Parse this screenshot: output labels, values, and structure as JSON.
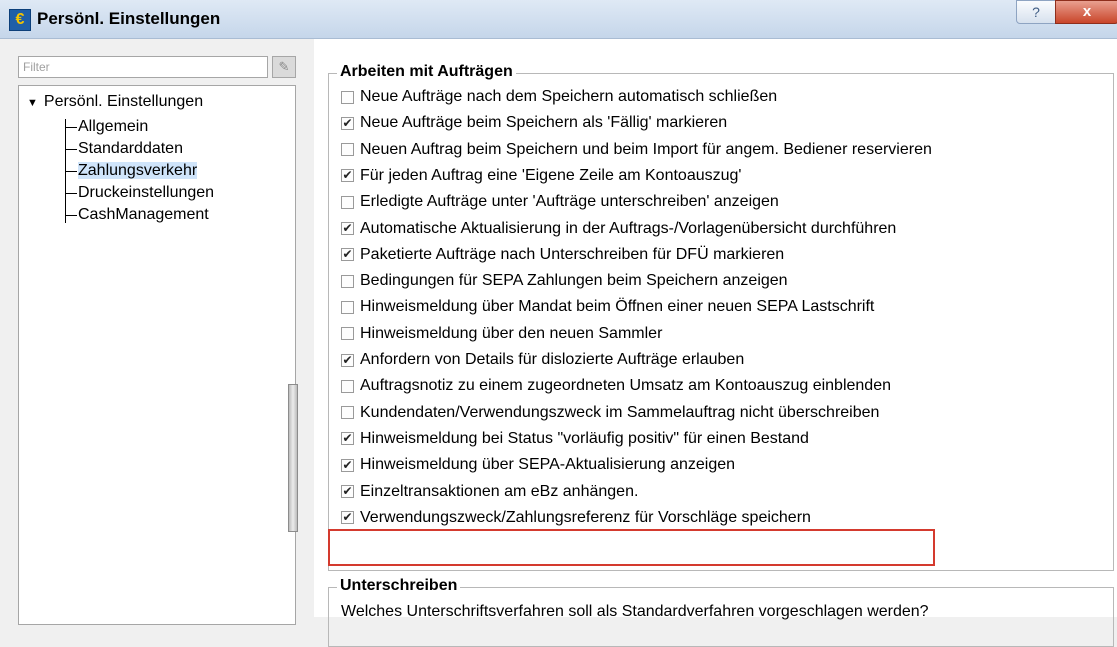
{
  "window": {
    "title": "Persönl. Einstellungen",
    "help_glyph": "?",
    "close_glyph": "x",
    "app_icon_glyph": "€"
  },
  "sidebar": {
    "filter_placeholder": "Filter",
    "tree": {
      "root": "Persönl. Einstellungen",
      "children": [
        "Allgemein",
        "Standarddaten",
        "Zahlungsverkehr",
        "Druckeinstellungen",
        "CashManagement"
      ],
      "selected": "Zahlungsverkehr"
    }
  },
  "main": {
    "group1": {
      "title": "Arbeiten mit Aufträgen",
      "options": [
        {
          "label": "Neue Aufträge nach dem Speichern automatisch schließen",
          "checked": false
        },
        {
          "label": "Neue Aufträge beim Speichern als 'Fällig' markieren",
          "checked": true
        },
        {
          "label": "Neuen Auftrag beim Speichern und beim Import für angem. Bediener reservieren",
          "checked": false
        },
        {
          "label": "Für jeden Auftrag eine 'Eigene Zeile am Kontoauszug'",
          "checked": true
        },
        {
          "label": "Erledigte Aufträge unter 'Aufträge unterschreiben' anzeigen",
          "checked": false
        },
        {
          "label": "Automatische Aktualisierung in der Auftrags-/Vorlagenübersicht durchführen",
          "checked": true
        },
        {
          "label": "Paketierte Aufträge nach Unterschreiben für DFÜ markieren",
          "checked": true
        },
        {
          "label": "Bedingungen für SEPA Zahlungen beim Speichern anzeigen",
          "checked": false
        },
        {
          "label": "Hinweismeldung über Mandat beim Öffnen einer neuen SEPA Lastschrift",
          "checked": false
        },
        {
          "label": "Hinweismeldung über den neuen Sammler",
          "checked": false
        },
        {
          "label": "Anfordern von Details für dislozierte Aufträge erlauben",
          "checked": true
        },
        {
          "label": "Auftragsnotiz zu einem zugeordneten Umsatz am Kontoauszug einblenden",
          "checked": false
        },
        {
          "label": "Kundendaten/Verwendungszweck im Sammelauftrag nicht überschreiben",
          "checked": false
        },
        {
          "label": "Hinweismeldung bei Status \"vorläufig positiv\" für einen Bestand",
          "checked": true
        },
        {
          "label": "Hinweismeldung über SEPA-Aktualisierung anzeigen",
          "checked": true
        },
        {
          "label": "Einzeltransaktionen am eBz anhängen.",
          "checked": true
        },
        {
          "label": "Verwendungszweck/Zahlungsreferenz für Vorschläge speichern",
          "checked": true
        }
      ]
    },
    "group2": {
      "title": "Unterschreiben",
      "question": "Welches Unterschriftsverfahren soll als Standardverfahren vorgeschlagen werden?"
    }
  }
}
